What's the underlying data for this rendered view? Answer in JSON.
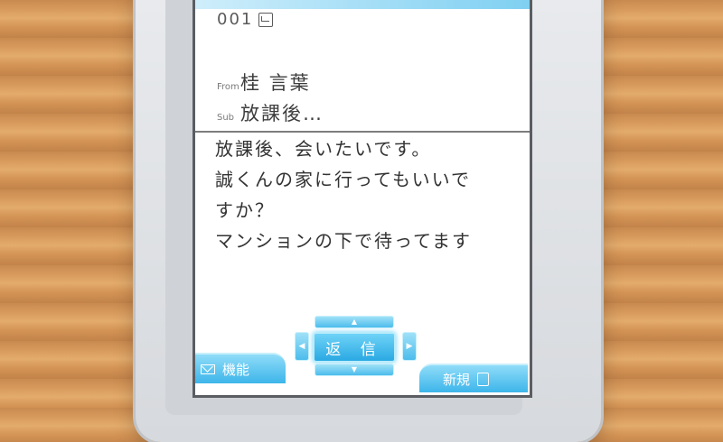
{
  "message": {
    "number": "001",
    "read_icon": "read-mail-icon",
    "from_tag": "From",
    "from_name": "桂 言葉",
    "subject_tag": "Sub",
    "subject": "放課後…",
    "body_lines": [
      "放課後、会いたいです。",
      "誠くんの家に行ってもいいで",
      "すか？",
      "マンションの下で待ってます"
    ]
  },
  "controls": {
    "reply_label": "返 信",
    "left_softkey_label": "機能",
    "right_softkey_label": "新規",
    "up_arrow": "▲",
    "down_arrow": "▼",
    "left_arrow": "◀",
    "right_arrow": "▶"
  },
  "colors": {
    "accent": "#3db5ea",
    "accent_light": "#8fdcf8",
    "screen_bg": "#ffffff",
    "text": "#333333"
  }
}
